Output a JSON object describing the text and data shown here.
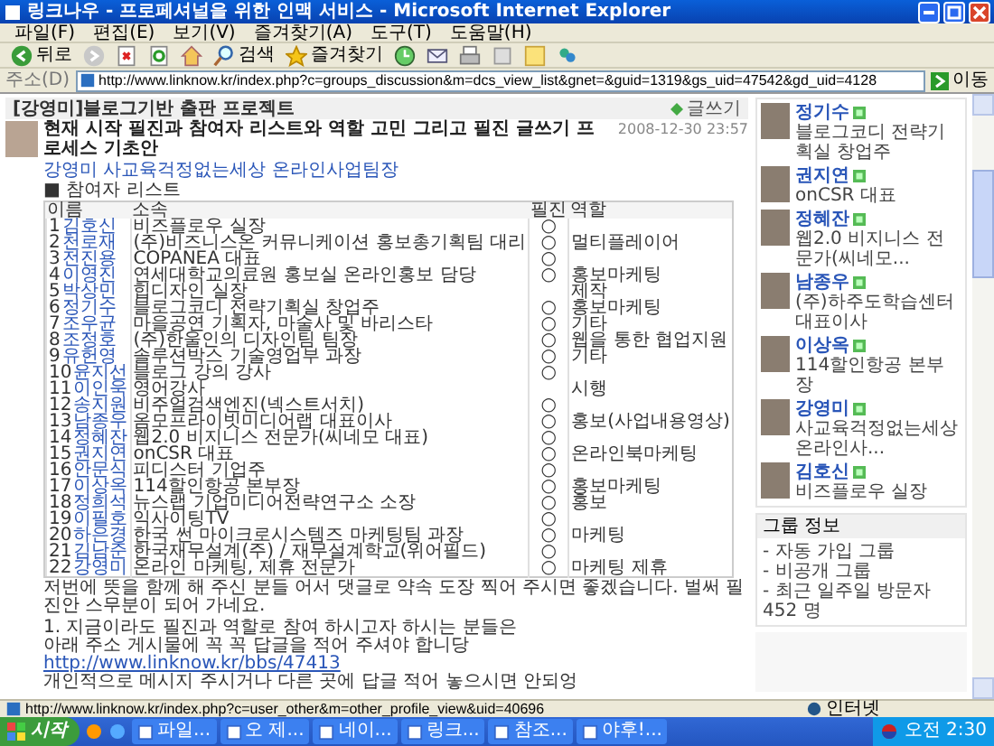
{
  "window": {
    "title": "링크나우 - 프로페셔널을 위한 인맥 서비스 - Microsoft Internet Explorer"
  },
  "menu": [
    "파일(F)",
    "편집(E)",
    "보기(V)",
    "즐겨찾기(A)",
    "도구(T)",
    "도움말(H)"
  ],
  "toolbar": {
    "back": "뒤로",
    "search": "검색",
    "favorites": "즐겨찾기"
  },
  "address": {
    "label": "주소(D)",
    "value": "http://www.linknow.kr/index.php?c=groups_discussion&m=dcs_view_list&gnet=&guid=1319&gs_uid=47542&gd_uid=4128",
    "go": "이동"
  },
  "group": {
    "title": "[강영미]블로그기반 출판 프로젝트",
    "write": "글쓰기"
  },
  "post": {
    "title": "현재 시작 필진과 참여자 리스트와 역할 고민 그리고 필진 글쓰기 프로세스 기초안",
    "date": "2008-12-30 23:57",
    "author": "강영미 사교육걱정없는세상 온라인사업팀장",
    "list_label": "■ 참여자 리스트",
    "table": {
      "columns": [
        "이름",
        "소속",
        "필진",
        "역할"
      ],
      "rows": [
        {
          "no": "1",
          "name": "김호신",
          "affiliation": "비즈플로우 실장",
          "writer": "○"
        },
        {
          "no": "2",
          "name": "천로재",
          "affiliation": "(주)비즈니스온 커뮤니케이션 홍보총기획팀 대리",
          "writer": "○",
          "role": "멀티플레이어"
        },
        {
          "no": "3",
          "name": "전진용",
          "affiliation": "COPANEA 대표",
          "writer": "○"
        },
        {
          "no": "4",
          "name": "이영진",
          "affiliation": "연세대학교의료원 홍보실 온라인홍보 담당",
          "writer": "○",
          "role": "홍보마케팅"
        },
        {
          "no": "5",
          "name": "박상민",
          "affiliation": "힙디자인 실장",
          "role": "제작"
        },
        {
          "no": "6",
          "name": "정기수",
          "affiliation": "블로그코디 전략기획실 창업주",
          "writer": "○",
          "role": "홍보마케팅"
        },
        {
          "no": "7",
          "name": "조우균",
          "affiliation": "마을공연 기획자, 마술사 및 바리스타",
          "writer": "○",
          "role": "기타"
        },
        {
          "no": "8",
          "name": "조정호",
          "affiliation": "(주)한울인의 디자인팀 팀장",
          "writer": "○",
          "role": "웹을 통한 협업지원"
        },
        {
          "no": "9",
          "name": "유헌영",
          "affiliation": "솔루션박스 기술영업부 과장",
          "writer": "○",
          "role": "기타"
        },
        {
          "no": "10",
          "name": "윤지선",
          "affiliation": "블로그 강의 강사",
          "writer": "○"
        },
        {
          "no": "11",
          "name": "이인욱",
          "affiliation": "영어강사",
          "role": "시행"
        },
        {
          "no": "12",
          "name": "송지원",
          "affiliation": "비주얼검색엔진(넥스트서치)",
          "writer": "○"
        },
        {
          "no": "13",
          "name": "남종우",
          "affiliation": "옴모프라이빗미디어랩 대표이사",
          "writer": "○",
          "role": "홍보(사업내용영상)"
        },
        {
          "no": "14",
          "name": "정혜잔",
          "affiliation": "웹2.0 비지니스 전문가(씨네모 대표)",
          "writer": "○"
        },
        {
          "no": "15",
          "name": "권지연",
          "affiliation": "onCSR 대표",
          "writer": "○",
          "role": "온라인북마케팅"
        },
        {
          "no": "16",
          "name": "안문식",
          "affiliation": "피디스터 기업주",
          "writer": "○"
        },
        {
          "no": "17",
          "name": "이상옥",
          "affiliation": "114할인항공 본부장",
          "writer": "○",
          "role": "홍보마케팅"
        },
        {
          "no": "18",
          "name": "정희석",
          "affiliation": "뉴스랩 기업미디어전략연구소 소장",
          "writer": "○",
          "role": "홍보"
        },
        {
          "no": "19",
          "name": "이필호",
          "affiliation": "익사이팅TV",
          "writer": "○"
        },
        {
          "no": "20",
          "name": "하은경",
          "affiliation": "한국 썬 마이크로시스템즈 마케팅팀 과장",
          "writer": "○",
          "role": "마케팅"
        },
        {
          "no": "21",
          "name": "김남준",
          "affiliation": "한국재무설계(주) / 재무설계학교(위어필드)",
          "writer": "○"
        },
        {
          "no": "22",
          "name": "강영미",
          "affiliation": "온라인 마케팅, 제휴 전문가",
          "writer": "○",
          "role": "마케팅 제휴"
        }
      ]
    },
    "body": [
      {
        "kind": "text",
        "text": "저번에 뜻을 함께 해 주신 분들 어서 댓글로 약속 도장 찍어 주시면 좋겠습니다. 벌써 필진안 스무분이 되어 가네요."
      },
      {
        "kind": "text",
        "text": "1. 지금이라도 필진과 역할로 참여 하시고자 하시는 분들은"
      },
      {
        "kind": "text",
        "text": "아래 주소 게시물에 꼭 꼭 답글을 적어 주셔야 합니당"
      },
      {
        "kind": "link",
        "text": "http://www.linknow.kr/bbs/47413"
      },
      {
        "kind": "text",
        "text": "개인적으로 메시지 주시거나 다른 곳에 답글 적어 놓으시면 안되엉"
      }
    ]
  },
  "members": [
    {
      "name": "정기수",
      "title": "블로그코디 전략기획실 창업주"
    },
    {
      "name": "권지연",
      "title": "onCSR 대표"
    },
    {
      "name": "정혜잔",
      "title": "웹2.0 비지니스 전문가(씨네모..."
    },
    {
      "name": "남종우",
      "title": "(주)하주도학습센터 대표이사"
    },
    {
      "name": "이상옥",
      "title": "114할인항공 본부장"
    },
    {
      "name": "강영미",
      "title": "사교육걱정없는세상 온라인사..."
    },
    {
      "name": "김호신",
      "title": "비즈플로우 실장"
    }
  ],
  "group_info": {
    "title": "그룹 정보",
    "items": [
      "- 자동 가입 그룹",
      "- 비공개 그룹",
      "- 최근 일주일 방문자 452 명"
    ]
  },
  "status_bar": {
    "url": "http://www.linknow.kr/index.php?c=user_other&m=other_profile_view&uid=40696",
    "zone": "인터넷"
  },
  "taskbar": {
    "start": "시작",
    "tasks": [
      "파일...",
      "오 제...",
      "네이...",
      "링크...",
      "참조...",
      "야후!..."
    ],
    "clock": "오전 2:30"
  }
}
